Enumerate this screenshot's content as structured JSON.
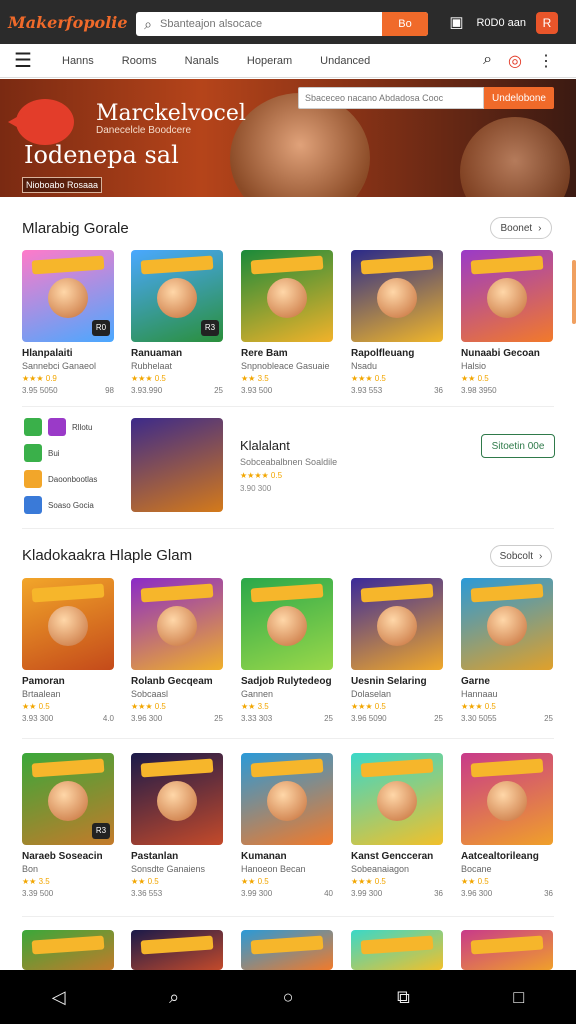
{
  "app": {
    "logo": "Makerfopolie",
    "search_placeholder": "Sbanteajon alsocace",
    "search_button": "Bo",
    "account": "R0D0 aan",
    "cart": "R"
  },
  "nav": {
    "tabs": [
      "Hanns",
      "Rooms",
      "Nanals",
      "Hoperam",
      "Undanced"
    ]
  },
  "hero": {
    "brand": "Marckelvocel",
    "sub": "Danecelcle Boodcere",
    "title": "Iodenepa sal",
    "cta": "Nioboabo Rosaaa",
    "search_placeholder": "Sbaceceo nacano Abdadosa Cooc",
    "search_button": "Undelobone"
  },
  "sections": [
    {
      "title": "Mlarabig Gorale",
      "see": "Boonet",
      "items": [
        {
          "name": "Hlanpalaiti",
          "dev": "Sannebci Ganaeol",
          "rating": "★★★ 0.9",
          "price": "3.95 5050",
          "size": "98",
          "badge": "R0",
          "colors": [
            "#ff7ac9",
            "#4aa8ff"
          ]
        },
        {
          "name": "Ranuaman",
          "dev": "Rubhelaat",
          "rating": "★★★ 0.5",
          "price": "3.93.990",
          "size": "25",
          "badge": "R3",
          "colors": [
            "#4aa8ff",
            "#2a8f3a"
          ]
        },
        {
          "name": "Rere Bam",
          "dev": "Snpnobleace Gasuaie",
          "rating": "★★ 3.5",
          "price": "3.93 500",
          "size": "",
          "badge": "",
          "colors": [
            "#1a8a3a",
            "#f2b22a"
          ]
        },
        {
          "name": "Rapolfleuang",
          "dev": "Nsadu",
          "rating": "★★★ 0.5",
          "price": "3.93 553",
          "size": "36",
          "badge": "",
          "colors": [
            "#2a2a8a",
            "#f0b62a"
          ]
        },
        {
          "name": "Nunaabi Gecoan",
          "dev": "Halsio",
          "rating": "★★ 0.5",
          "price": "3.98 3950",
          "size": "",
          "badge": "",
          "colors": [
            "#9a3ac8",
            "#f27a2a"
          ]
        }
      ]
    },
    {
      "title": "Kladokaakra Hlaple Glam",
      "see": "Sobcolt",
      "items": [
        {
          "name": "Pamoran",
          "dev": "Brtaalean",
          "rating": "★★ 0.5",
          "price": "3.93 300",
          "size": "4.0",
          "badge": "",
          "colors": [
            "#f2a62a",
            "#c44a1a"
          ]
        },
        {
          "name": "Rolanb Gecqeam",
          "dev": "Sobcaasl",
          "rating": "★★★ 0.5",
          "price": "3.96 300",
          "size": "25",
          "badge": "",
          "colors": [
            "#8a2ac8",
            "#f0b02a"
          ]
        },
        {
          "name": "Sadjob Rulytedeog",
          "dev": "Gannen",
          "rating": "★★ 3.5",
          "price": "3.33 303",
          "size": "25",
          "badge": "",
          "colors": [
            "#2aa84a",
            "#9ad84a"
          ]
        },
        {
          "name": "Uesnin Selaring",
          "dev": "Dolaselan",
          "rating": "★★★ 0.5",
          "price": "3.96 5090",
          "size": "25",
          "badge": "",
          "colors": [
            "#3a2a9a",
            "#f0a82a"
          ]
        },
        {
          "name": "Garne",
          "dev": "Hannaau",
          "rating": "★★★ 0.5",
          "price": "3.30 5055",
          "size": "25",
          "badge": "",
          "colors": [
            "#2a9ad8",
            "#e0a02a"
          ]
        }
      ]
    },
    {
      "title": "",
      "see": "",
      "items": [
        {
          "name": "Naraeb Soseacin",
          "dev": "Bon",
          "rating": "★★ 3.5",
          "price": "3.39 500",
          "size": "",
          "badge": "R3",
          "colors": [
            "#3aa83a",
            "#c47a2a"
          ]
        },
        {
          "name": "Pastanlan",
          "dev": "Sonsdte Ganaiens",
          "rating": "★★ 0.5",
          "price": "3.36 553",
          "size": "",
          "badge": "",
          "colors": [
            "#1a1a4a",
            "#c44a2a"
          ]
        },
        {
          "name": "Kumanan",
          "dev": "Hanoeon Becan",
          "rating": "★★ 0.5",
          "price": "3.99 300",
          "size": "40",
          "badge": "",
          "colors": [
            "#2a9ad8",
            "#f27a2a"
          ]
        },
        {
          "name": "Kanst Gencceran",
          "dev": "Sobeanaiagon",
          "rating": "★★★ 0.5",
          "price": "3.99 300",
          "size": "36",
          "badge": "",
          "colors": [
            "#3ad8c8",
            "#f2c02a"
          ]
        },
        {
          "name": "Aatcealtorileang",
          "dev": "Bocane",
          "rating": "★★ 0.5",
          "price": "3.96 300",
          "size": "36",
          "badge": "",
          "colors": [
            "#c83a8a",
            "#f0a02a"
          ]
        }
      ]
    }
  ],
  "featured": {
    "name": "Klalalant",
    "dev": "Sobceabalbnen Soaldile",
    "rating": "★★★★ 0.5",
    "price": "3.90 300",
    "button": "Sitoetin 00e",
    "apps": [
      {
        "label": "Bui",
        "color": "#3ab04a"
      },
      {
        "label": "Daoonbootlas",
        "color": "#f2a62a"
      },
      {
        "label": "Soaso Gocia",
        "color": "#3a7ad8"
      }
    ],
    "apps_top": "Rllotu"
  },
  "bottom": {
    "back": "◁",
    "assistant": "⌕",
    "home": "○",
    "recent": "⧉",
    "square": "□"
  }
}
